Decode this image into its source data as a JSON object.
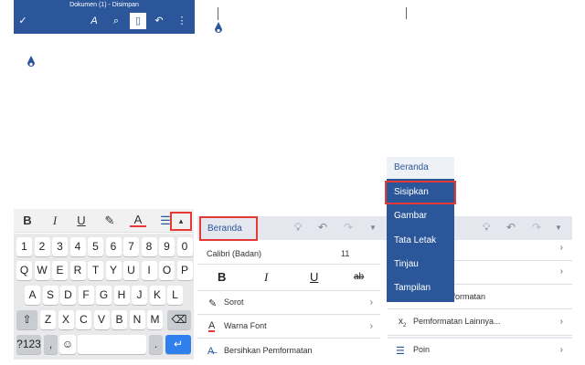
{
  "doc_title": "Dokumen (1) - Disimpan",
  "titlebar_icons": [
    "check-icon",
    "draw-icon",
    "search-icon",
    "phone-view-icon",
    "undo-icon",
    "more-icon"
  ],
  "format_bar": {
    "bold": "B",
    "italic": "I",
    "underline": "U",
    "highlight": "✎",
    "font_color": "A",
    "list": "☰",
    "caret": "▴"
  },
  "keyboard": {
    "row1": [
      "1",
      "2",
      "3",
      "4",
      "5",
      "6",
      "7",
      "8",
      "9",
      "0"
    ],
    "row2": [
      "Q",
      "W",
      "E",
      "R",
      "T",
      "Y",
      "U",
      "I",
      "O",
      "P"
    ],
    "row3": [
      "A",
      "S",
      "D",
      "F",
      "G",
      "H",
      "J",
      "K",
      "L"
    ],
    "row4": [
      "Z",
      "X",
      "C",
      "V",
      "B",
      "N",
      "M"
    ],
    "special": {
      "shift": "⇧",
      "backspace": "⌫",
      "num": "?123",
      "comma": ",",
      "emoji": "☺",
      "period": ".",
      "enter": "↵"
    }
  },
  "ribbon": {
    "tab_label": "Beranda",
    "font_name": "Calibri (Badan)",
    "font_size": "11",
    "bold": "B",
    "italic": "I",
    "underline": "U",
    "strike": "ab",
    "highlight_label": "Sorot",
    "font_color_label": "Warna Font",
    "clear_label": "Bersihkan Pemformatan"
  },
  "tab_menu": {
    "items": [
      "Beranda",
      "Sisipkan",
      "Gambar",
      "Tata Letak",
      "Tinjau",
      "Tampilan"
    ]
  },
  "right_panel": {
    "partial_label": "mformatan",
    "more_format_label": "Pemformatan Lainnya...",
    "points_label": "Poin"
  },
  "colors": {
    "accent": "#2b579a",
    "highlight_border": "#e53935",
    "font_color_underline": "#e53935"
  }
}
